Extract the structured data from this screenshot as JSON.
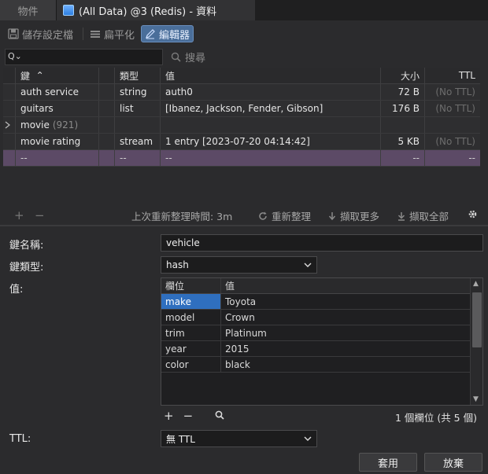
{
  "tabs": [
    {
      "label": "物件",
      "active": false
    },
    {
      "label": "(All Data) @3 (Redis) - 資料",
      "active": true
    }
  ],
  "toolbar": {
    "save_profile": "儲存設定檔",
    "flatten": "扁平化",
    "editor": "編輯器"
  },
  "search": {
    "value": "",
    "button": "搜尋"
  },
  "table": {
    "headers": {
      "key": "鍵",
      "type": "類型",
      "value": "值",
      "size": "大小",
      "ttl": "TTL"
    },
    "rows": [
      {
        "key": "auth service",
        "count": "",
        "type": "string",
        "value": "auth0",
        "size": "72 B",
        "ttl": "(No TTL)"
      },
      {
        "key": "guitars",
        "count": "",
        "type": "list",
        "value": "[Ibanez, Jackson, Fender, Gibson]",
        "size": "176 B",
        "ttl": "(No TTL)"
      },
      {
        "key": "movie",
        "count": "(921)",
        "type": "",
        "value": "",
        "size": "",
        "ttl": ""
      },
      {
        "key": "movie rating",
        "count": "",
        "type": "stream",
        "value": "1 entry [2023-07-20 04:14:42]",
        "size": "5 KB",
        "ttl": "(No TTL)"
      },
      {
        "key": "--",
        "count": "",
        "type": "--",
        "value": "--",
        "size": "--",
        "ttl": "--"
      }
    ]
  },
  "statusbar": {
    "last_refresh": "上次重新整理時間: 3m",
    "refresh": "重新整理",
    "fetch_more": "擷取更多",
    "fetch_all": "擷取全部"
  },
  "editor": {
    "key_name_label": "鍵名稱:",
    "key_name_value": "vehicle",
    "key_type_label": "鍵類型:",
    "key_type_value": "hash",
    "value_label": "值:",
    "field_headers": {
      "name": "欄位",
      "value": "值"
    },
    "fields": [
      {
        "name": "make",
        "value": "Toyota"
      },
      {
        "name": "model",
        "value": "Crown"
      },
      {
        "name": "trim",
        "value": "Platinum"
      },
      {
        "name": "year",
        "value": "2015"
      },
      {
        "name": "color",
        "value": "black"
      }
    ],
    "field_count": "1 個欄位 (共 5 個)",
    "ttl_label": "TTL:",
    "ttl_value": "無 TTL",
    "apply": "套用",
    "discard": "放棄"
  }
}
